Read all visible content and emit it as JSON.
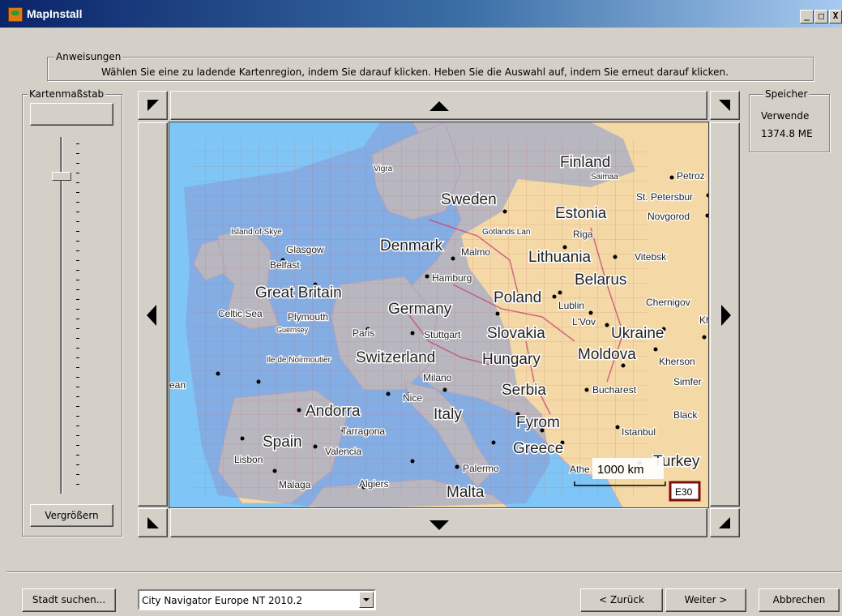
{
  "window": {
    "title": "MapInstall",
    "min_label": "_",
    "max_label": "□",
    "close_label": "X"
  },
  "instructions": {
    "group_label": "Anweisungen",
    "text": "Wählen Sie eine zu ladende Kartenregion, indem Sie darauf klicken. Heben Sie die Auswahl auf, indem Sie erneut darauf klicken."
  },
  "scale": {
    "group_label": "Kartenmaßstab",
    "zoom_in_label": "Vergrößern",
    "slider_level": 0.11
  },
  "memory": {
    "group_label": "Speicher",
    "line1": "Verwende",
    "line2": "1374.8 ME"
  },
  "map": {
    "scale_bar_label": "1000 km",
    "badge_label": "E30",
    "countries": [
      "Finland",
      "Sweden",
      "Estonia",
      "Denmark",
      "Lithuania",
      "Belarus",
      "Great Britain",
      "Germany",
      "Poland",
      "Slovakia",
      "Ukraine",
      "Switzerland",
      "Hungary",
      "Moldova",
      "Serbia",
      "Andorra",
      "Italy",
      "Fyrom",
      "Spain",
      "Greece",
      "Turkey",
      "Malta"
    ],
    "cities": [
      "Vigra",
      "Saimaa",
      "Petroz",
      "St. Petersbur",
      "Novgorod",
      "Riga",
      "Gotlands Lan",
      "Island of Skye",
      "Glasgow",
      "Malmo",
      "Belfast",
      "Vitebsk",
      "Hamburg",
      "Celtic Sea",
      "Plymouth",
      "Lublin",
      "Chernigov",
      "Guernsey",
      "Paris",
      "Stuttgart",
      "L'Vov",
      "Kh",
      "Ile de Noirmoutier",
      "Kherson",
      "Milano",
      "Simfer",
      "ean",
      "Bucharest",
      "Nice",
      "Black",
      "Tarragona",
      "Istanbul",
      "Valencia",
      "Lisbon",
      "Palermo",
      "Athe",
      "Malaga",
      "Algiers"
    ]
  },
  "footer": {
    "find_city_label": "Stadt suchen...",
    "map_select_value": "City Navigator Europe NT 2010.2",
    "back_label": "< Zurück",
    "next_label": "Weiter >",
    "cancel_label": "Abbrechen"
  },
  "colors": {
    "sea": "#7fc5f5",
    "land": "#f4d9a6",
    "selected_tile": "#8799d4",
    "window_bg": "#d4d0c8"
  }
}
